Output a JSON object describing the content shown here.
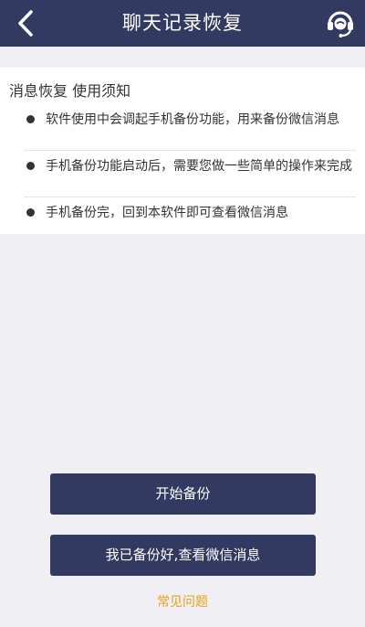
{
  "header": {
    "title": "聊天记录恢复",
    "back_icon": "chevron-left-icon",
    "support_icon": "customer-service-headset-icon",
    "background_color": "#333a61"
  },
  "notice": {
    "heading": "消息恢复 使用须知",
    "items": [
      {
        "text": "软件使用中会调起手机备份功能，用来备份微信消息"
      },
      {
        "text": "手机备份功能启动后，需要您做一些简单的操作来完成"
      },
      {
        "text": "手机备份完，回到本软件即可查看微信消息"
      }
    ]
  },
  "actions": {
    "start_backup_label": "开始备份",
    "view_messages_label": "我已备份好,查看微信消息",
    "button_color": "#333a61"
  },
  "faq": {
    "label": "常见问题",
    "color": "#e8a317"
  }
}
